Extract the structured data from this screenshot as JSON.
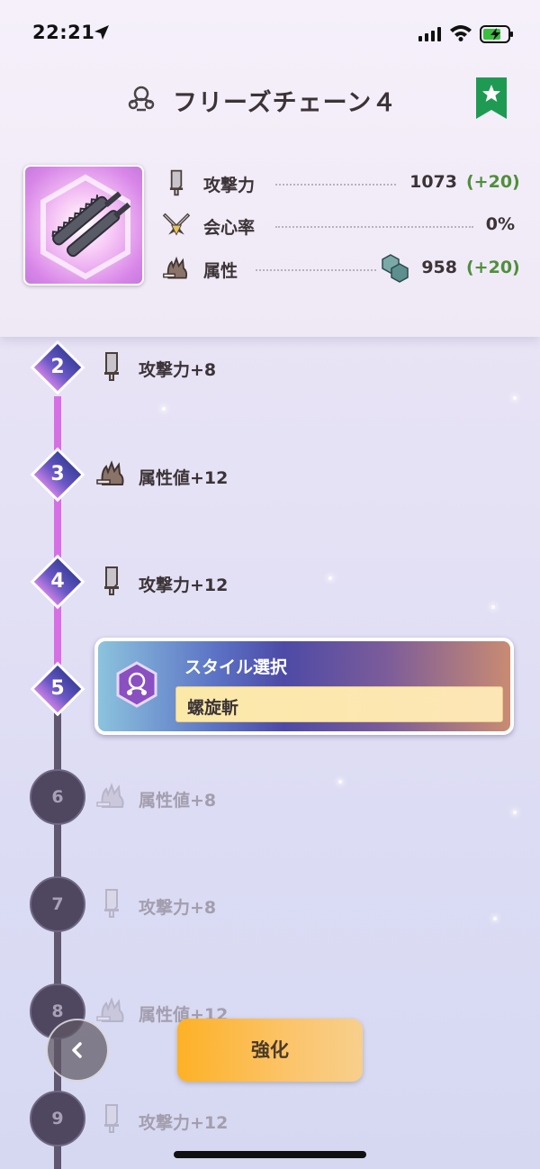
{
  "status_bar": {
    "time": "22:21"
  },
  "header": {
    "title": "フリーズチェーン４",
    "icons": {
      "title": "style-emblem-icon",
      "favorite": "star-bookmark-icon"
    }
  },
  "weapon": {
    "thumbnail_icon": "chain-blade-weapon-icon",
    "stats": [
      {
        "label": "攻撃力",
        "value": "1073",
        "bonus": "(+20)",
        "icon": "blade-icon"
      },
      {
        "label": "会心率",
        "value": "0%",
        "bonus": "",
        "icon": "crossed-swords-icon"
      },
      {
        "label": "属性",
        "value": "958",
        "bonus": "(+20)",
        "icon": "flame-fist-icon",
        "element_icon": "ice-element-icon"
      }
    ]
  },
  "levels": [
    {
      "num": "2",
      "label": "攻撃力+8",
      "icon": "blade-icon",
      "state": "unlocked"
    },
    {
      "num": "3",
      "label": "属性値+12",
      "icon": "flame-fist-icon",
      "state": "unlocked"
    },
    {
      "num": "4",
      "label": "攻撃力+12",
      "icon": "blade-icon",
      "state": "unlocked"
    },
    {
      "num": "5",
      "label": "",
      "icon": "",
      "state": "current"
    },
    {
      "num": "6",
      "label": "属性値+8",
      "icon": "flame-fist-icon",
      "state": "locked"
    },
    {
      "num": "7",
      "label": "攻撃力+8",
      "icon": "blade-icon",
      "state": "locked"
    },
    {
      "num": "8",
      "label": "属性値+12",
      "icon": "flame-fist-icon",
      "state": "locked"
    },
    {
      "num": "9",
      "label": "攻撃力+12",
      "icon": "blade-icon",
      "state": "locked"
    }
  ],
  "style_select": {
    "title": "スタイル選択",
    "value": "螺旋斬",
    "icon": "style-emblem-icon"
  },
  "actions": {
    "enhance_label": "強化",
    "back_icon": "chevron-left-icon"
  },
  "colors": {
    "active_track": "#d86ee6",
    "inactive_track": "#5f566f",
    "bonus_green": "#4e8f3b",
    "enhance_orange": "#fdb126",
    "favorite_green": "#1f9a53"
  }
}
